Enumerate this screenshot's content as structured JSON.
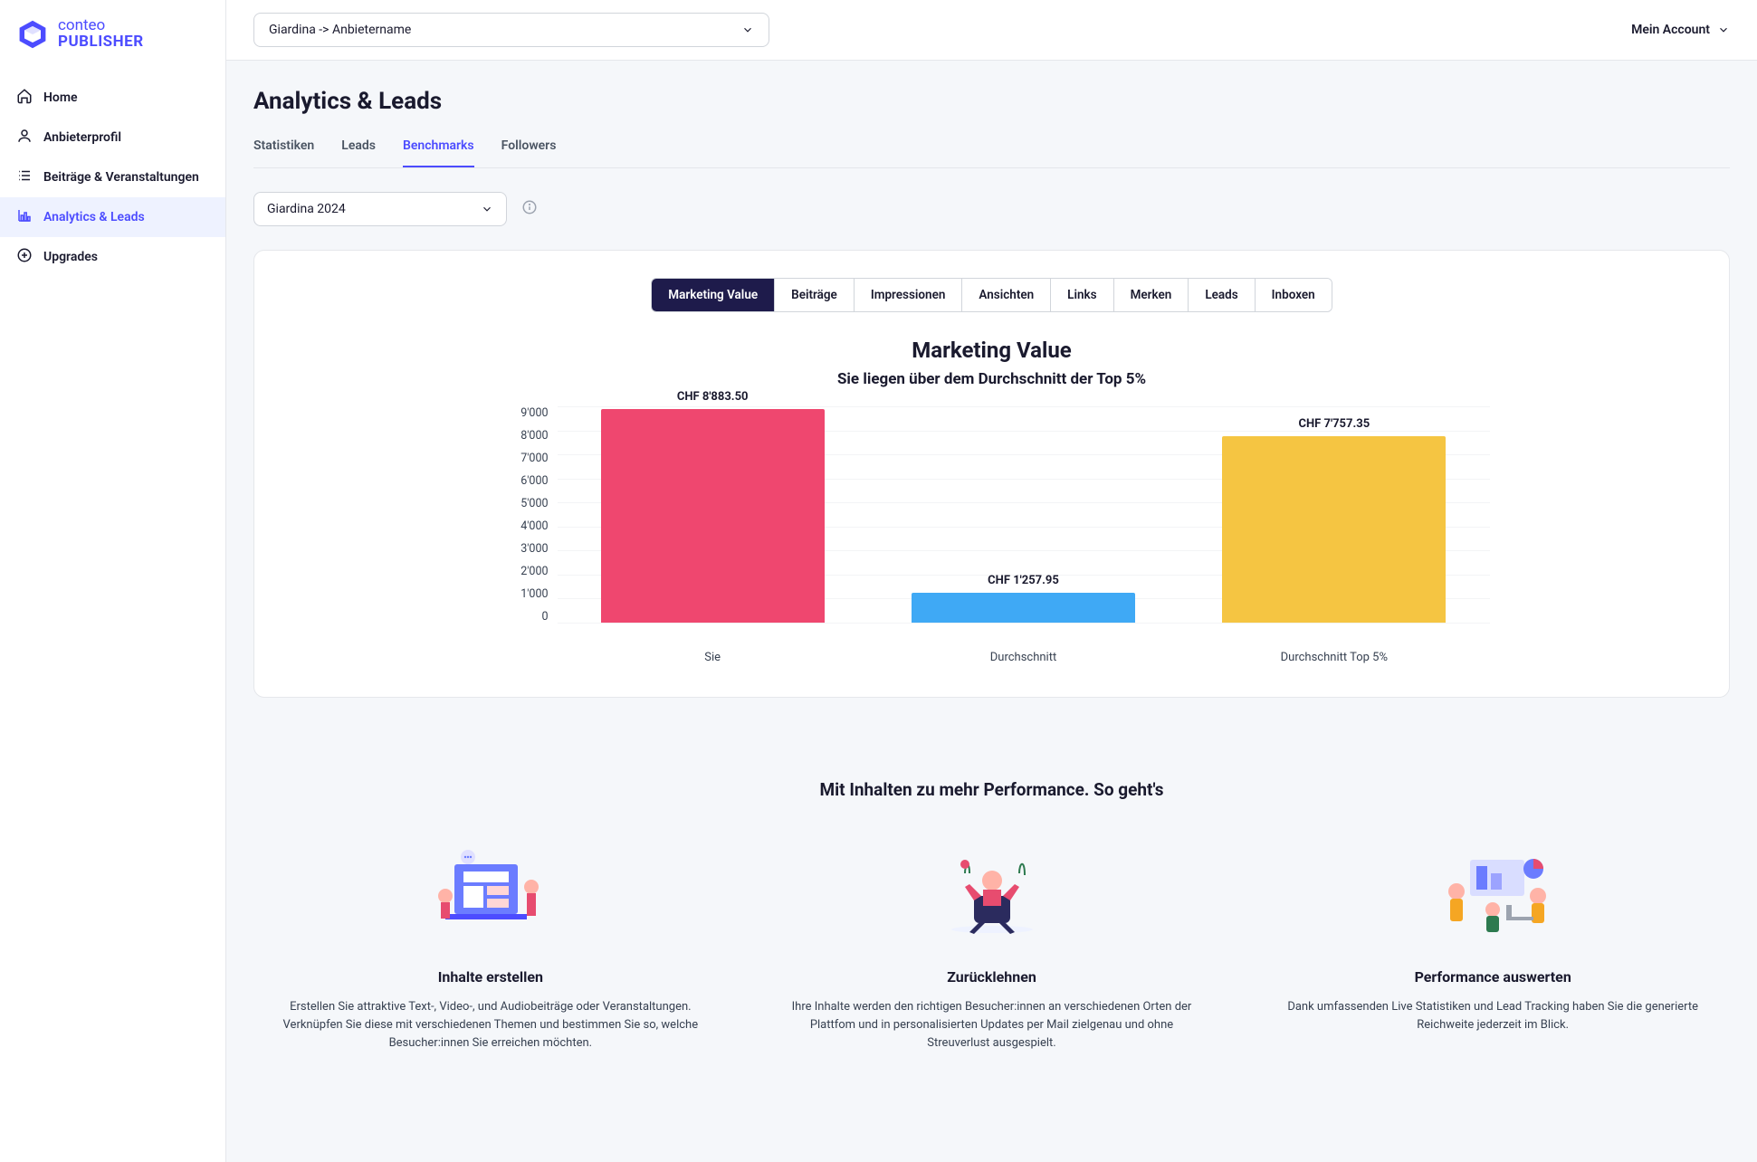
{
  "brand": {
    "line1": "conteo",
    "line2": "PUBLISHER"
  },
  "nav": {
    "items": [
      {
        "label": "Home",
        "icon": "home"
      },
      {
        "label": "Anbieterprofil",
        "icon": "user"
      },
      {
        "label": "Beiträge & Veranstaltungen",
        "icon": "list"
      },
      {
        "label": "Analytics & Leads",
        "icon": "chart",
        "active": true
      },
      {
        "label": "Upgrades",
        "icon": "plus-circle"
      }
    ]
  },
  "topbar": {
    "org_selector": "Giardina -> Anbietername",
    "account": "Mein Account"
  },
  "page": {
    "title": "Analytics & Leads"
  },
  "tabs": [
    {
      "label": "Statistiken"
    },
    {
      "label": "Leads"
    },
    {
      "label": "Benchmarks",
      "active": true
    },
    {
      "label": "Followers"
    }
  ],
  "filter": {
    "selected": "Giardina 2024"
  },
  "segmented": [
    {
      "label": "Marketing Value",
      "active": true
    },
    {
      "label": "Beiträge"
    },
    {
      "label": "Impressionen"
    },
    {
      "label": "Ansichten"
    },
    {
      "label": "Links"
    },
    {
      "label": "Merken"
    },
    {
      "label": "Leads"
    },
    {
      "label": "Inboxen"
    }
  ],
  "chart_data": {
    "type": "bar",
    "title": "Marketing Value",
    "subtitle": "Sie liegen über dem Durchschnitt der Top 5%",
    "categories": [
      "Sie",
      "Durchschnitt",
      "Durchschnitt Top 5%"
    ],
    "values": [
      8883.5,
      1257.95,
      7757.35
    ],
    "value_labels": [
      "CHF 8'883.50",
      "CHF 1'257.95",
      "CHF 7'757.35"
    ],
    "colors": [
      "#ef476f",
      "#3fa9f5",
      "#f5c542"
    ],
    "ylim": [
      0,
      9000
    ],
    "yticks": [
      "9'000",
      "8'000",
      "7'000",
      "6'000",
      "5'000",
      "4'000",
      "3'000",
      "2'000",
      "1'000",
      "0"
    ],
    "xlabel": "",
    "ylabel": ""
  },
  "promo": {
    "title": "Mit Inhalten zu mehr Performance. So geht's",
    "cols": [
      {
        "head": "Inhalte erstellen",
        "body": "Erstellen Sie attraktive Text-, Video-, und Audiobeiträge oder Veranstaltungen. Verknüpfen Sie diese mit verschiedenen Themen und bestimmen Sie so, welche Besucher:innen Sie erreichen möchten."
      },
      {
        "head": "Zurücklehnen",
        "body": "Ihre Inhalte werden den richtigen Besucher:innen an verschiedenen Orten der Plattfom und in personalisierten Updates per Mail zielgenau und ohne Streuverlust ausgespielt."
      },
      {
        "head": "Performance auswerten",
        "body": "Dank umfassenden Live Statistiken und Lead Tracking haben Sie die generierte Reichweite jederzeit im Blick."
      }
    ]
  }
}
